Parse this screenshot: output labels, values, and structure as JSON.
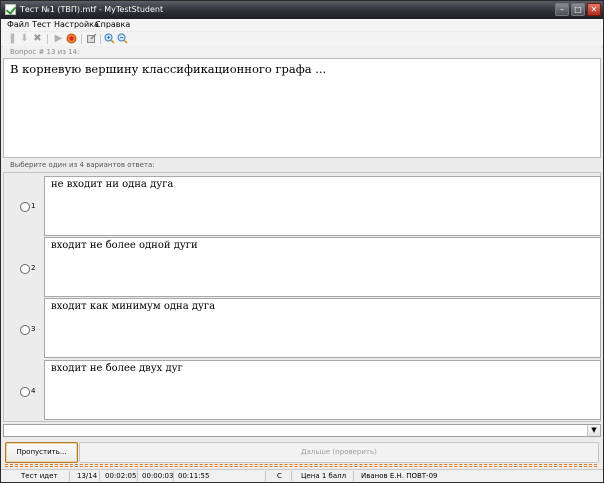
{
  "window": {
    "title": "Тест №1 (ТВП).mtf - MyTestStudent",
    "min_label": "–",
    "max_label": "□",
    "close_label": "✕"
  },
  "menu": [
    "Файл",
    "Тест",
    "Настройка",
    "Справка"
  ],
  "toolbar_icons": [
    "pause-icon",
    "down-arrow-icon",
    "stop-x-icon",
    "play-icon",
    "record-icon",
    "export-icon",
    "zoom-in-icon",
    "zoom-out-icon"
  ],
  "question": {
    "header": "Вопрос # 13 из 14:",
    "text": "В корневую вершину классификационного графа ..."
  },
  "answers": {
    "header": "Выберите один из 4 вариантов ответа:",
    "items": [
      {
        "num": "1",
        "text": "не входит ни одна дуга"
      },
      {
        "num": "2",
        "text": "входит не более одной дуги"
      },
      {
        "num": "3",
        "text": "входит как минимум одна дуга"
      },
      {
        "num": "4",
        "text": "входит не более двух дуг"
      }
    ]
  },
  "buttons": {
    "skip": "Пропустить...",
    "next": "Дальше (проверить)"
  },
  "status": {
    "state": "Тест идет",
    "progress": "13/14",
    "time_elapsed": "00:02:05",
    "time_question": "00:00:03",
    "time_left": "00:11:55",
    "mode": "С",
    "price": "Цена 1 балл",
    "user": "Иванов Е.Н. ПОВТ-09"
  },
  "colors": {
    "titlebar": "#2d3035",
    "progress": "#e87a20",
    "skip_border": "#b07a30"
  }
}
